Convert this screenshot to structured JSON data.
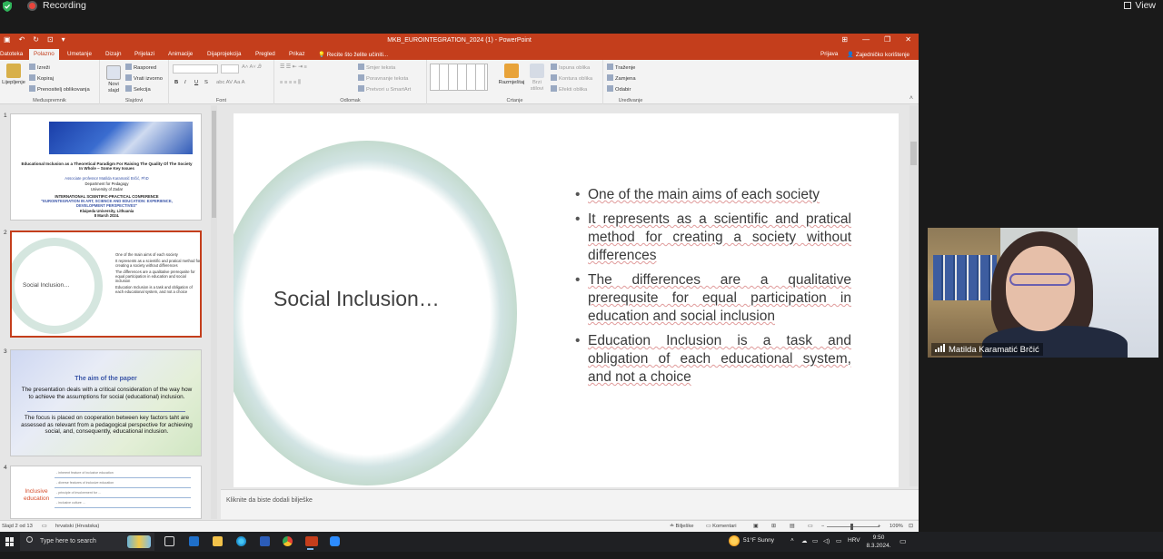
{
  "zoom": {
    "recording_label": "Recording",
    "view_label": "View",
    "participant": {
      "name": "Matilda Karamatić Brčić"
    }
  },
  "ppt": {
    "window_title": "MKB_EUROINTEGRATION_2024 (1) - PowerPoint",
    "menu_tabs": [
      "Datoteka",
      "Polazno",
      "Umetanje",
      "Dizajn",
      "Prijelazi",
      "Animacije",
      "Dijaprojekcija",
      "Pregled",
      "Prikaz"
    ],
    "active_tab": "Polazno",
    "tell_me": "Recite što želite učiniti...",
    "share": "Prijava",
    "share2": "Zajedničko korištenje",
    "ribbon": {
      "clipboard": {
        "paste": "Lijepljenje",
        "cut": "Izreži",
        "copy": "Kopiraj",
        "format_painter": "Prenositelj oblikovanja",
        "label": "Međuspremnik"
      },
      "slides": {
        "new_slide": "Novi slajd",
        "layout": "Raspored",
        "reset": "Vrati izvorno",
        "section": "Sekcija",
        "label": "Slajdovi"
      },
      "font": {
        "bold": "B",
        "italic": "I",
        "underline": "U",
        "strike": "S",
        "label": "Font"
      },
      "paragraph": {
        "text_direction": "Smjer teksta",
        "align_text": "Poravnanje teksta",
        "smartart": "Pretvori u SmartArt",
        "label": "Odlomak"
      },
      "drawing": {
        "arrange": "Razmještaj",
        "quick_styles": "Brzi stilovi",
        "fill": "Ispuna oblika",
        "outline": "Kontura oblika",
        "effects": "Efekti oblika",
        "label": "Crtanje"
      },
      "editing": {
        "find": "Traženje",
        "replace": "Zamjena",
        "select": "Odabir",
        "label": "Uređivanje"
      }
    },
    "thumbnails": {
      "slide1": {
        "num": "1",
        "title": "Educational Inclusion as a Theoretical Paradigm For Raising The Quality Of The Society In Whole – Some Key Issues",
        "author": "Associate professor Matilda Karamatić Brčić, PhD",
        "dept": "Department for Pedagogy",
        "uni": "University of Zadar",
        "conf": "INTERNATIONAL SCIENTIFIC-PRACTICAL CONFERENCE",
        "conf_name": "\"EUROINTEGRATION IN ART, SCIENCE AND EDUCATION: EXPERIENCE, DEVELOPMENT PERSPECTIVES\"",
        "place": "Klaipeda University, Lithuania",
        "date": "8 March 2024."
      },
      "slide2": {
        "num": "2",
        "title": "Social Inclusion…",
        "bullets": [
          "One of the main aims of each society",
          "It represents as a scientific and pratical method for creating a society without differences",
          "The differences are a qualitative prerequsite for equal participation in education and social inclusion",
          "Education Inclusion is a task and obligation of each educational system, and not a choice"
        ]
      },
      "slide3": {
        "num": "3",
        "title": "The aim of the paper",
        "p1": "The presentation deals with a critical consideration of the way how to achieve the assumptions for social (educational) inclusion.",
        "p2": "The focus is placed on cooperation between key factors taht are assessed as relevant from a pedagogical perspective for achieving social, and, consequently, educational inclusion."
      },
      "slide4": {
        "num": "4",
        "title": "Inclusive education",
        "lines": [
          "- inherent feature of inclusive education",
          "- diverse features of inclusive education",
          "- principle of involvement for ...",
          "- inclusive culture ..."
        ]
      }
    },
    "slide": {
      "title": "Social Inclusion…",
      "bullets": [
        "One of the main aims of each society",
        "It represents as a scientific and pratical method for creating a society without differences",
        "The differences are a qualitative prerequsite for equal participation in education and social inclusion",
        "Education Inclusion is a task and obligation of each educational system, and not a choice"
      ]
    },
    "notes_placeholder": "Kliknite da biste dodali bilješke",
    "status": {
      "slide_count": "Slajd 2 od 13",
      "language": "hrvatski (Hrvatska)",
      "notes": "Bilješke",
      "comments": "Komentari",
      "zoom": "109%"
    }
  },
  "taskbar": {
    "search_placeholder": "Type here to search",
    "weather": "51°F  Sunny",
    "lang": "HRV",
    "time": "9:50",
    "date": "8.3.2024."
  }
}
